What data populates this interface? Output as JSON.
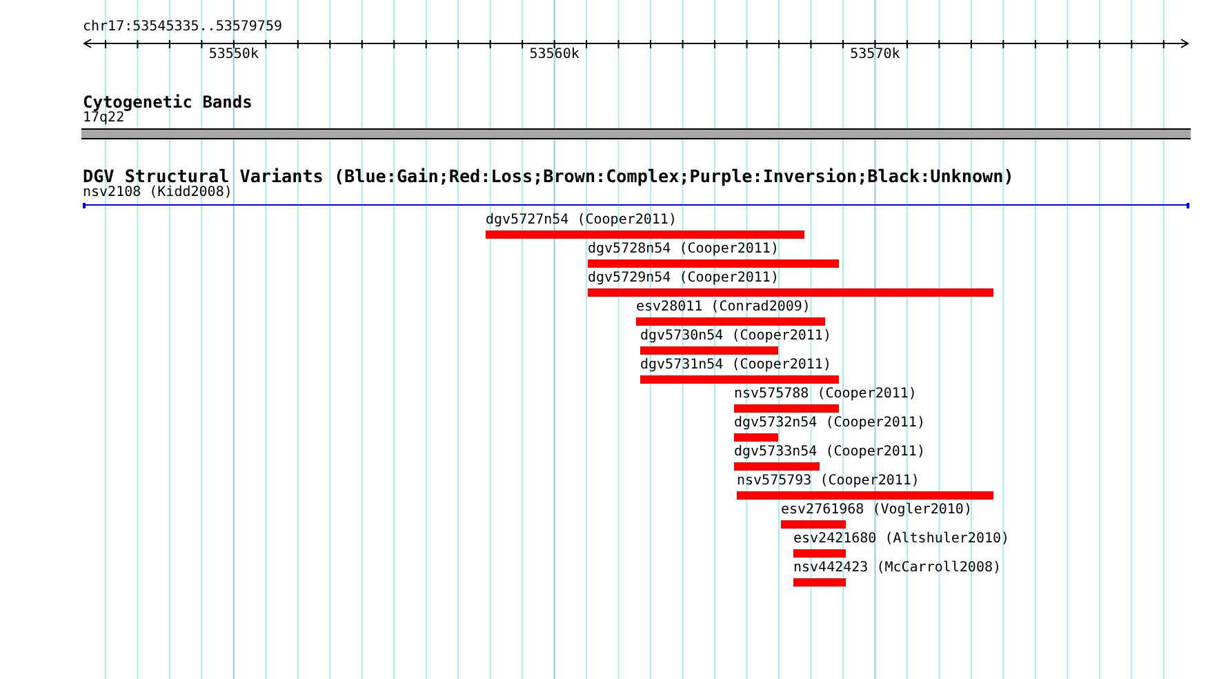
{
  "ruler": {
    "label": "chr17:53545335..53579759",
    "tick_labels": [
      "53550k",
      "53560k",
      "53570k"
    ]
  },
  "cytobands": {
    "title": "Cytogenetic Bands",
    "band_label": "17q22"
  },
  "dgv": {
    "title": "DGV Structural Variants (Blue:Gain;Red:Loss;Brown:Complex;Purple:Inversion;Black:Unknown)",
    "spanning_variant": {
      "label": "nsv2108 (Kidd2008)",
      "color": "#0000ff"
    },
    "features": [
      {
        "label": "dgv5727n54 (Cooper2011)",
        "color": "#ff0000"
      },
      {
        "label": "dgv5728n54 (Cooper2011)",
        "color": "#ff0000"
      },
      {
        "label": "dgv5729n54 (Cooper2011)",
        "color": "#ff0000"
      },
      {
        "label": "esv28011 (Conrad2009)",
        "color": "#ff0000"
      },
      {
        "label": "dgv5730n54 (Cooper2011)",
        "color": "#ff0000"
      },
      {
        "label": "dgv5731n54 (Cooper2011)",
        "color": "#ff0000"
      },
      {
        "label": "nsv575788 (Cooper2011)",
        "color": "#ff0000"
      },
      {
        "label": "dgv5732n54 (Cooper2011)",
        "color": "#ff0000"
      },
      {
        "label": "dgv5733n54 (Cooper2011)",
        "color": "#ff0000"
      },
      {
        "label": "nsv575793 (Cooper2011)",
        "color": "#ff0000"
      },
      {
        "label": "esv2761968 (Vogler2010)",
        "color": "#ff0000"
      },
      {
        "label": "esv2421680 (Altshuler2010)",
        "color": "#ff0000"
      },
      {
        "label": "nsv442423 (McCarroll2008)",
        "color": "#ff0000"
      }
    ]
  }
}
